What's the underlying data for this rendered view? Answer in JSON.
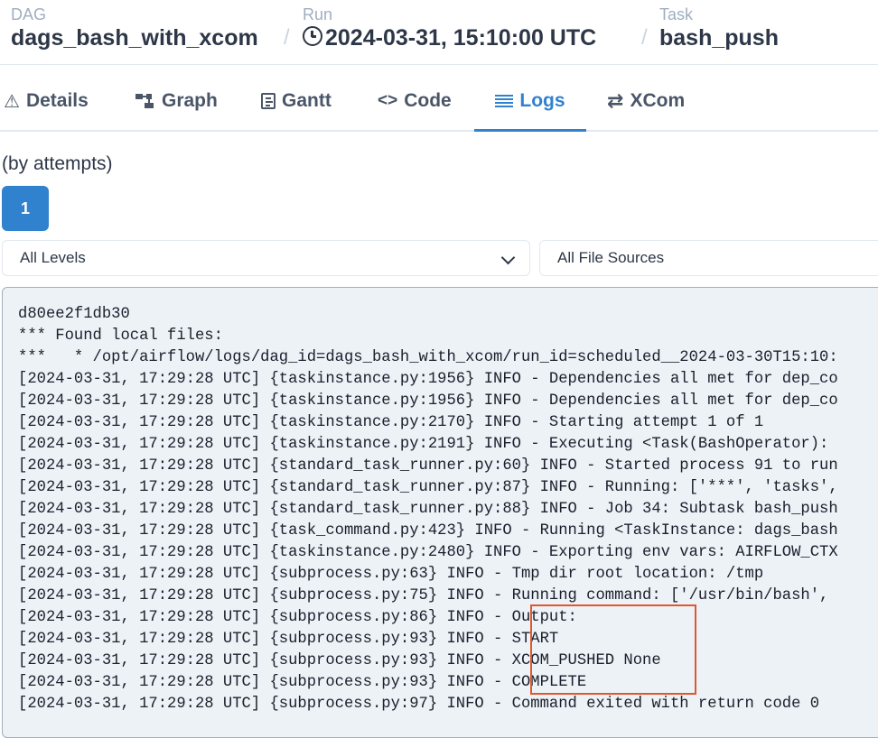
{
  "breadcrumb": {
    "dag": {
      "label": "DAG",
      "value": "dags_bash_with_xcom"
    },
    "run": {
      "label": "Run",
      "value": "2024-03-31, 15:10:00 UTC"
    },
    "task": {
      "label": "Task",
      "value": "bash_push"
    },
    "separator": "/"
  },
  "tabs": [
    {
      "label": "Details",
      "icon": "warning-triangle-icon"
    },
    {
      "label": "Graph",
      "icon": "graph-icon"
    },
    {
      "label": "Gantt",
      "icon": "gantt-icon"
    },
    {
      "label": "Code",
      "icon": "code-icon"
    },
    {
      "label": "Logs",
      "icon": "logs-icon",
      "active": true
    },
    {
      "label": "XCom",
      "icon": "swap-arrows-icon"
    }
  ],
  "attempts": {
    "label": "(by attempts)",
    "buttons": [
      "1"
    ]
  },
  "filters": {
    "levels": "All Levels",
    "sources": "All File Sources"
  },
  "log_lines": [
    "d80ee2f1db30",
    "*** Found local files:",
    "***   * /opt/airflow/logs/dag_id=dags_bash_with_xcom/run_id=scheduled__2024-03-30T15:10:",
    "[2024-03-31, 17:29:28 UTC] {taskinstance.py:1956} INFO - Dependencies all met for dep_co",
    "[2024-03-31, 17:29:28 UTC] {taskinstance.py:1956} INFO - Dependencies all met for dep_co",
    "[2024-03-31, 17:29:28 UTC] {taskinstance.py:2170} INFO - Starting attempt 1 of 1",
    "[2024-03-31, 17:29:28 UTC] {taskinstance.py:2191} INFO - Executing <Task(BashOperator):",
    "[2024-03-31, 17:29:28 UTC] {standard_task_runner.py:60} INFO - Started process 91 to run",
    "[2024-03-31, 17:29:28 UTC] {standard_task_runner.py:87} INFO - Running: ['***', 'tasks',",
    "[2024-03-31, 17:29:28 UTC] {standard_task_runner.py:88} INFO - Job 34: Subtask bash_push",
    "[2024-03-31, 17:29:28 UTC] {task_command.py:423} INFO - Running <TaskInstance: dags_bash",
    "[2024-03-31, 17:29:28 UTC] {taskinstance.py:2480} INFO - Exporting env vars: AIRFLOW_CTX",
    "[2024-03-31, 17:29:28 UTC] {subprocess.py:63} INFO - Tmp dir root location: /tmp",
    "[2024-03-31, 17:29:28 UTC] {subprocess.py:75} INFO - Running command: ['/usr/bin/bash',",
    "[2024-03-31, 17:29:28 UTC] {subprocess.py:86} INFO - Output:",
    "[2024-03-31, 17:29:28 UTC] {subprocess.py:93} INFO - START",
    "[2024-03-31, 17:29:28 UTC] {subprocess.py:93} INFO - XCOM_PUSHED None",
    "[2024-03-31, 17:29:28 UTC] {subprocess.py:93} INFO - COMPLETE",
    "[2024-03-31, 17:29:28 UTC] {subprocess.py:97} INFO - Command exited with return code 0"
  ],
  "colors": {
    "accent": "#3182ce",
    "highlight": "#e0572f"
  }
}
